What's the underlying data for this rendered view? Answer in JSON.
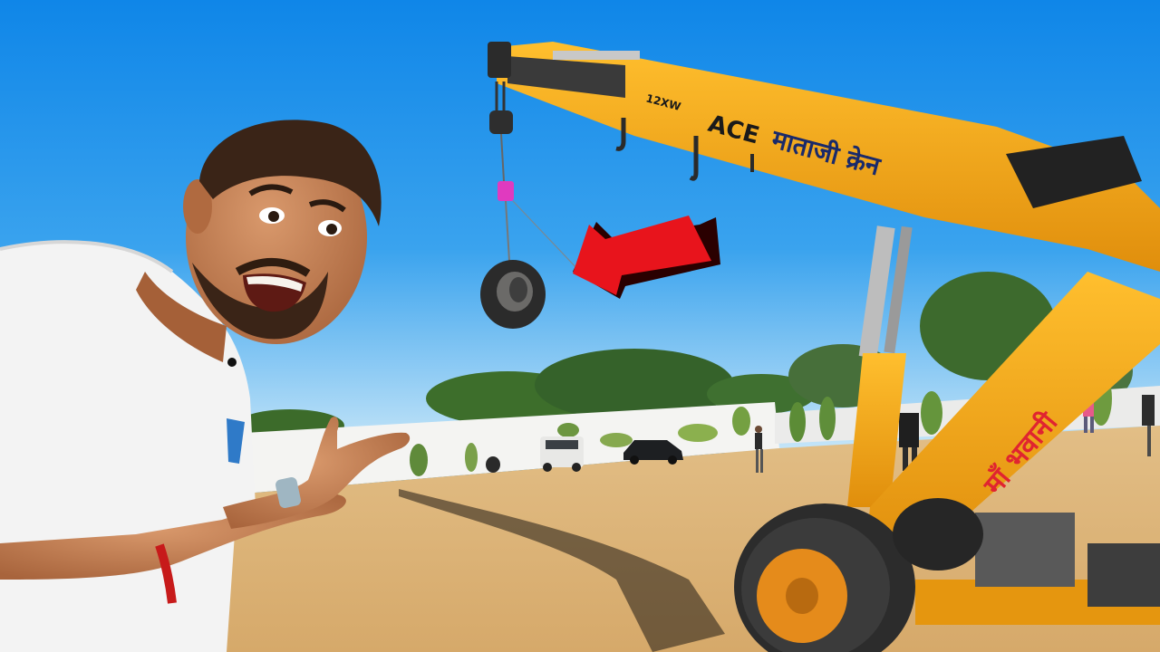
{
  "scene": {
    "crane_brand": "ACE",
    "crane_model": "12XW",
    "crane_owner_text": "माताजी क्रेन",
    "crane_mast_text": "माँ भवानी"
  },
  "colors": {
    "sky_top": "#0f86e8",
    "sky_bottom": "#bfe2f7",
    "ground": "#dcb47a",
    "crane_yellow": "#f2a51a",
    "arrow_red": "#e8141c",
    "shirt_white": "#f3f3f3"
  },
  "icons": {
    "arrow": "red-arrow-icon"
  }
}
